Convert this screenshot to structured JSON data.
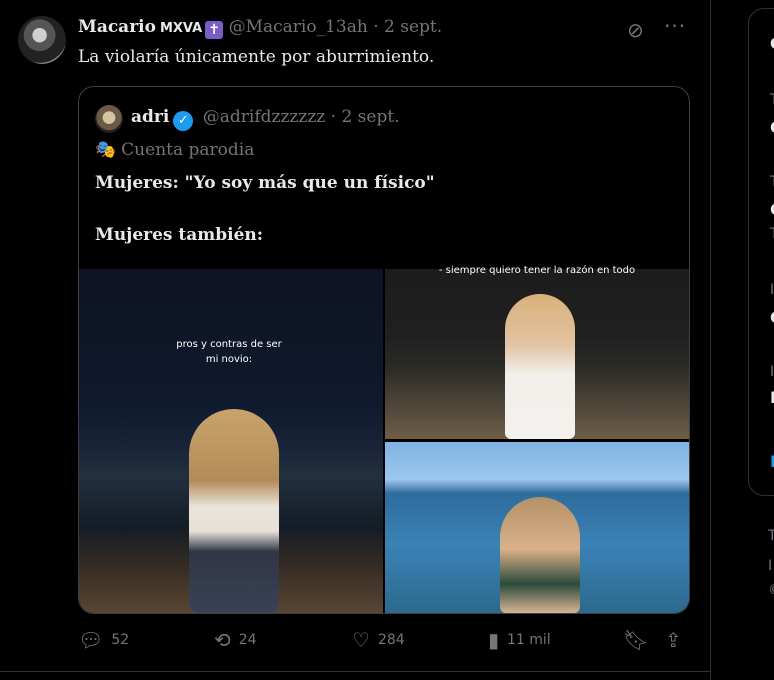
{
  "tweet": {
    "author_name": "Macario",
    "author_tag": "MXVA",
    "author_emoji": "✝",
    "handle": "@Macario_13ah",
    "separator": "·",
    "date": "2 sept.",
    "text": "La violaría únicamente por aburrimiento."
  },
  "quoted": {
    "author_name": "adri",
    "verified_mark": "✓",
    "handle": "@adrifdzzzzzz",
    "separator": "·",
    "date": "2 sept.",
    "parody_icon": "🎭",
    "parody_label": "Cuenta parodia",
    "line1": "Mujeres: \"Yo soy más que un físico\"",
    "line2": "Mujeres también:",
    "images": [
      {
        "caption": "pros y contras de ser mi novio:"
      },
      {
        "caption": "- siempre quiero tener la razón en todo"
      },
      {
        "caption": ""
      }
    ]
  },
  "actions": {
    "replies": "52",
    "reposts": "24",
    "likes": "284",
    "views": "11 mil"
  },
  "icons": {
    "reply": "reply-icon",
    "repost": "repost-icon",
    "like": "heart-icon",
    "views": "views-icon",
    "bookmark": "bookmark-icon",
    "share": "share-icon",
    "grok": "grok-icon",
    "more": "more-icon"
  },
  "sidebar_fragments": [
    "C",
    "T",
    "C",
    "T",
    "C",
    "T",
    "I",
    "C",
    "I",
    "E",
    "I"
  ],
  "footer_fragments": [
    "T",
    "I",
    "©"
  ],
  "colors": {
    "background": "#000000",
    "text": "#e7e9ea",
    "muted": "#71767b",
    "border": "#2f3336",
    "verified": "#1d9bf0",
    "cross_badge": "#7b5cc4"
  }
}
